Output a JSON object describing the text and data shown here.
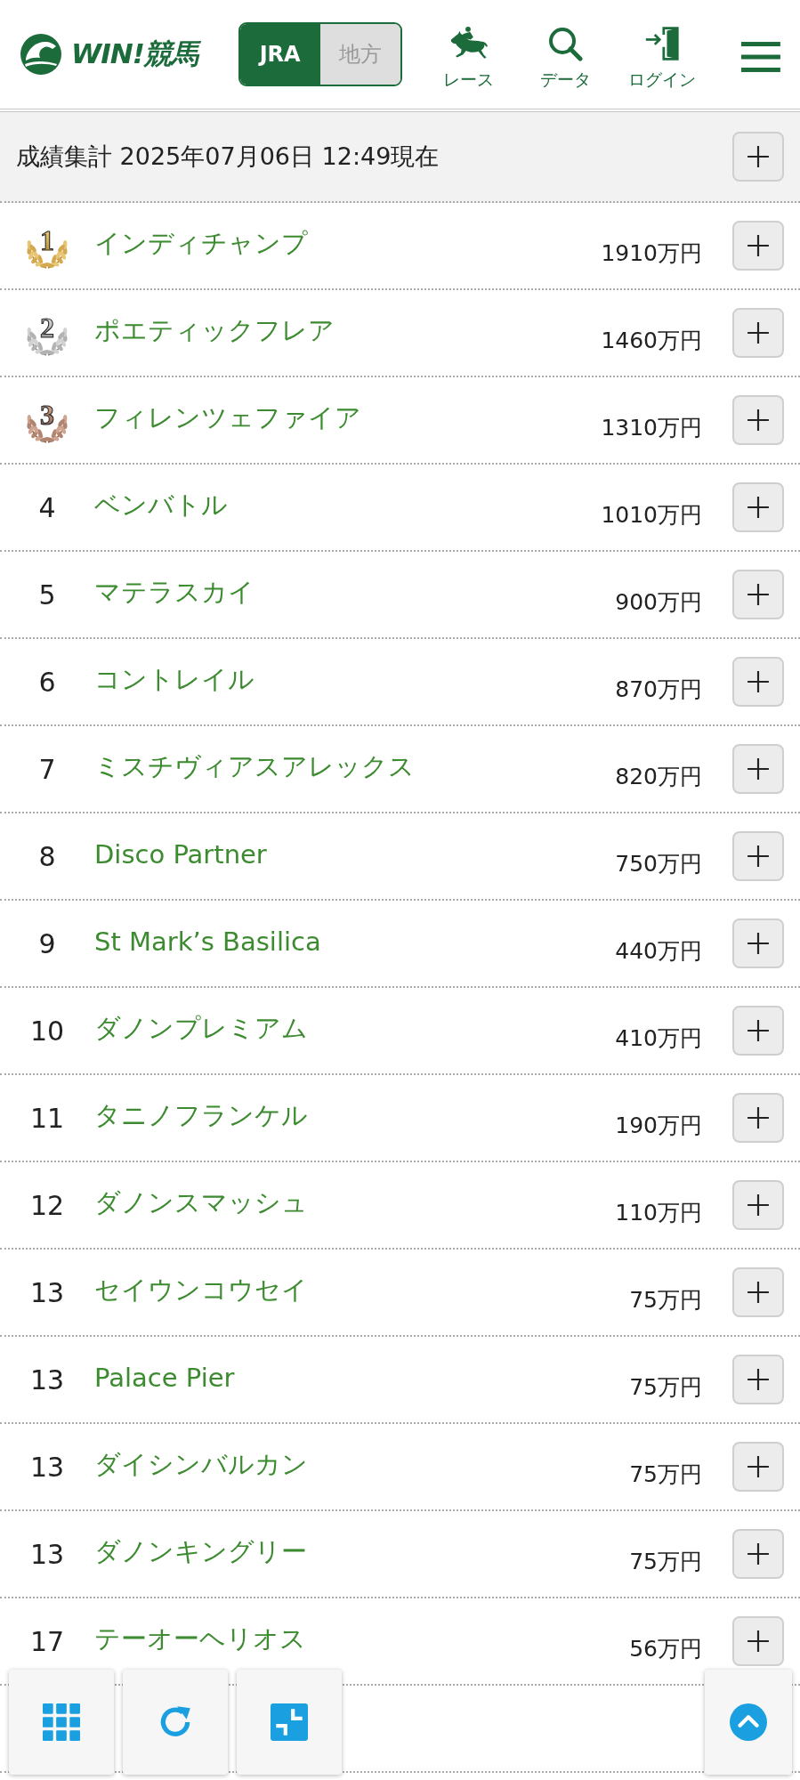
{
  "header": {
    "logo": {
      "text": "WIN!競馬"
    },
    "source_tabs": [
      {
        "label": "JRA",
        "selected": true
      },
      {
        "label": "地方",
        "selected": false
      }
    ],
    "nav": [
      {
        "label": "レース"
      },
      {
        "label": "データ"
      },
      {
        "label": "ログイン"
      }
    ]
  },
  "summary": {
    "title": "成績集計 2025年07月06日 12:49現在"
  },
  "rows": [
    {
      "rank": "1",
      "kind": "gold",
      "name": "インディチャンプ",
      "prize": "1910万円"
    },
    {
      "rank": "2",
      "kind": "silver",
      "name": "ポエティックフレア",
      "prize": "1460万円"
    },
    {
      "rank": "3",
      "kind": "bronze",
      "name": "フィレンツェファイア",
      "prize": "1310万円"
    },
    {
      "rank": "4",
      "kind": "number",
      "name": "ベンバトル",
      "prize": "1010万円"
    },
    {
      "rank": "5",
      "kind": "number",
      "name": "マテラスカイ",
      "prize": "900万円"
    },
    {
      "rank": "6",
      "kind": "number",
      "name": "コントレイル",
      "prize": "870万円"
    },
    {
      "rank": "7",
      "kind": "number",
      "name": "ミスチヴィアスアレックス",
      "prize": "820万円"
    },
    {
      "rank": "8",
      "kind": "number",
      "name": "Disco Partner",
      "prize": "750万円"
    },
    {
      "rank": "9",
      "kind": "number",
      "name": "St Mark’s Basilica",
      "prize": "440万円"
    },
    {
      "rank": "10",
      "kind": "number",
      "name": "ダノンプレミアム",
      "prize": "410万円"
    },
    {
      "rank": "11",
      "kind": "number",
      "name": "タニノフランケル",
      "prize": "190万円"
    },
    {
      "rank": "12",
      "kind": "number",
      "name": "ダノンスマッシュ",
      "prize": "110万円"
    },
    {
      "rank": "13",
      "kind": "number",
      "name": "セイウンコウセイ",
      "prize": "75万円"
    },
    {
      "rank": "13",
      "kind": "number",
      "name": "Palace Pier",
      "prize": "75万円"
    },
    {
      "rank": "13",
      "kind": "number",
      "name": "ダイシンバルカン",
      "prize": "75万円"
    },
    {
      "rank": "13",
      "kind": "number",
      "name": "ダノンキングリー",
      "prize": "75万円"
    },
    {
      "rank": "17",
      "kind": "number",
      "name": "テーオーヘリオス",
      "prize": "56万円"
    }
  ]
}
